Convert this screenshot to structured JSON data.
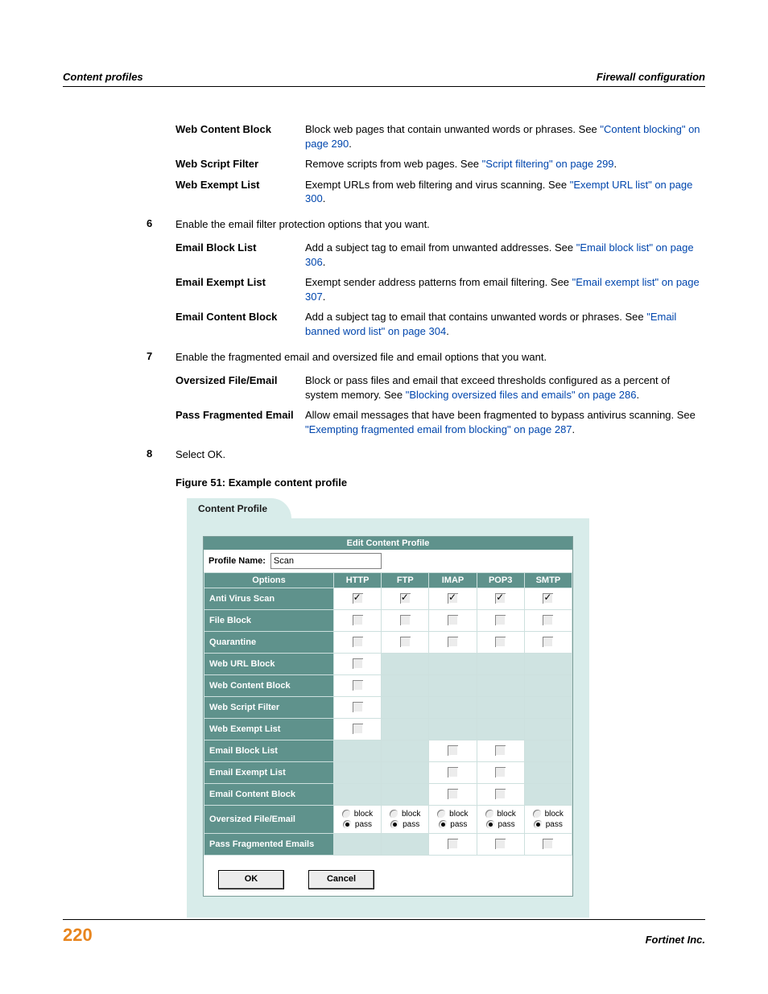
{
  "header": {
    "left": "Content profiles",
    "right": "Firewall configuration"
  },
  "footer": {
    "page": "220",
    "company": "Fortinet Inc."
  },
  "defs_a": [
    {
      "label": "Web Content Block",
      "text": "Block web pages that contain unwanted words or phrases. See ",
      "link": "\"Content blocking\" on page 290",
      "tail": "."
    },
    {
      "label": "Web Script Filter",
      "text": "Remove scripts from web pages. See ",
      "link": "\"Script filtering\" on page 299",
      "tail": "."
    },
    {
      "label": "Web Exempt List",
      "text": "Exempt URLs from web filtering and virus scanning. See ",
      "link": "\"Exempt URL list\" on page 300",
      "tail": "."
    }
  ],
  "step6": "Enable the email filter protection options that you want.",
  "defs_b": [
    {
      "label": "Email Block List",
      "text": "Add a subject tag to email from unwanted addresses. See ",
      "link": "\"Email block list\" on page 306",
      "tail": "."
    },
    {
      "label": "Email Exempt List",
      "text": "Exempt sender address patterns from email filtering. See ",
      "link": "\"Email exempt list\" on page 307",
      "tail": "."
    },
    {
      "label": "Email Content Block",
      "text": "Add a subject tag to email that contains unwanted words or phrases. See ",
      "link": "\"Email banned word list\" on page 304",
      "tail": "."
    }
  ],
  "step7": "Enable the fragmented email and oversized file and email options that you want.",
  "defs_c": [
    {
      "label": "Oversized File/Email",
      "text": "Block or pass files and email that exceed thresholds configured as a percent of system memory. See ",
      "link": "\"Blocking oversized files and emails\" on page 286",
      "tail": "."
    },
    {
      "label": "Pass Fragmented Email",
      "text": "Allow email messages that have been fragmented to bypass antivirus scanning. See ",
      "link": "\"Exempting fragmented email from blocking\" on page 287",
      "tail": "."
    }
  ],
  "step8": "Select OK.",
  "figure_caption": "Figure 51: Example content profile",
  "sshot": {
    "tab_label": "Content Profile",
    "titlebar": "Edit Content Profile",
    "profile_name_label": "Profile Name:",
    "profile_name_value": "Scan",
    "columns": [
      "Options",
      "HTTP",
      "FTP",
      "IMAP",
      "POP3",
      "SMTP"
    ],
    "rows": [
      {
        "label": "Anti Virus Scan",
        "cells": [
          "c",
          "c",
          "c",
          "c",
          "c"
        ]
      },
      {
        "label": "File Block",
        "cells": [
          "u",
          "u",
          "u",
          "u",
          "u"
        ]
      },
      {
        "label": "Quarantine",
        "cells": [
          "u",
          "u",
          "u",
          "u",
          "u"
        ]
      },
      {
        "label": "Web URL Block",
        "cells": [
          "u",
          "b",
          "b",
          "b",
          "b"
        ]
      },
      {
        "label": "Web Content Block",
        "cells": [
          "u",
          "b",
          "b",
          "b",
          "b"
        ]
      },
      {
        "label": "Web Script Filter",
        "cells": [
          "u",
          "b",
          "b",
          "b",
          "b"
        ]
      },
      {
        "label": "Web Exempt List",
        "cells": [
          "u",
          "b",
          "b",
          "b",
          "b"
        ]
      },
      {
        "label": "Email Block List",
        "cells": [
          "b",
          "b",
          "u",
          "u",
          "b"
        ]
      },
      {
        "label": "Email Exempt List",
        "cells": [
          "b",
          "b",
          "u",
          "u",
          "b"
        ]
      },
      {
        "label": "Email Content Block",
        "cells": [
          "b",
          "b",
          "u",
          "u",
          "b"
        ]
      },
      {
        "label": "Oversized File/Email",
        "cells": [
          "r",
          "r",
          "r",
          "r",
          "r"
        ]
      },
      {
        "label": "Pass Fragmented Emails",
        "cells": [
          "b",
          "b",
          "u",
          "u",
          "u"
        ]
      }
    ],
    "radio_block": "block",
    "radio_pass": "pass",
    "btn_ok": "OK",
    "btn_cancel": "Cancel"
  }
}
